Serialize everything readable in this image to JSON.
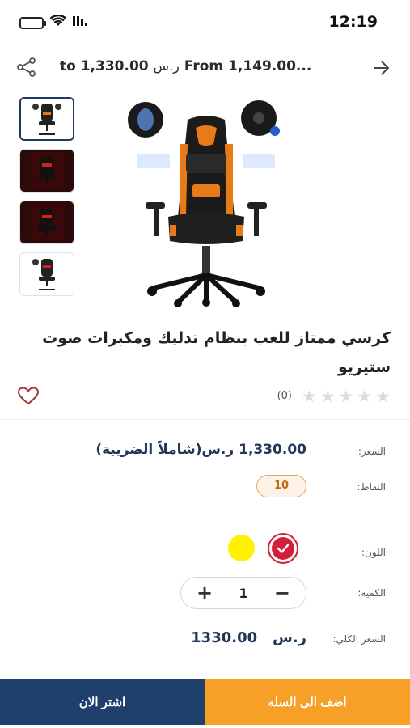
{
  "status_bar": {
    "time": "12:19",
    "wifi_icon": "wifi-icon",
    "signal_icon": "signal-icon",
    "battery_icon": "battery-icon"
  },
  "header": {
    "price_from_text": "From 1,149.00...",
    "currency_short": "ر.س",
    "price_to_text": "to 1,330.00",
    "share_icon": "share-icon",
    "back_icon": "arrow-right-icon"
  },
  "gallery": {
    "thumbnails_count": 4,
    "active_index": 0
  },
  "product": {
    "title": "كرسي ممتاز للعب بنظام تدليك ومكبرات صوت ستيريو",
    "rating_stars": 0,
    "review_count": "(0)"
  },
  "details": {
    "price_label": "السعر:",
    "price_value": "1,330.00 ر.س(شاملاً الضريبة)",
    "points_label": "النقاط:",
    "points_value": "10",
    "color_label": "اللون:",
    "colors": [
      {
        "name": "red",
        "hex": "#d3203a",
        "selected": true
      },
      {
        "name": "yellow",
        "hex": "#fff200",
        "selected": false
      }
    ],
    "quantity_label": "الكميه:",
    "quantity_value": "1",
    "plus_symbol": "+",
    "minus_symbol": "−",
    "total_label": "السعر الكلي:",
    "total_amount": "1330.00",
    "total_currency": "ر.س"
  },
  "actions": {
    "add_to_cart": "اضف الى السله",
    "buy_now": "اشتر الان"
  },
  "colors": {
    "primary": "#1f3f6c",
    "accent": "#f6a028",
    "price": "#22365a"
  }
}
